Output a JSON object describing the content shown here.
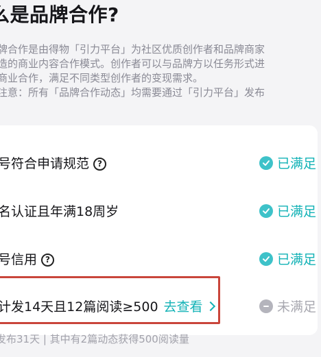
{
  "title": "么是品牌合作?",
  "description_lines": [
    "牌合作是由得物「引力平台」为社区优质创作者和品牌商家",
    "造的商业内容合作模式。创作者可以与品牌方以任务形式进",
    "商业合作，满足不同类型创作者的变现需求。",
    "注意：所有「品牌合作动态」均需要通过「引力平台」发布"
  ],
  "requirements": [
    {
      "label": "号符合申请规范",
      "help": "?",
      "status_text": "已满足",
      "status": "met"
    },
    {
      "label": "名认证且年满18周岁",
      "status_text": "已满足",
      "status": "met"
    },
    {
      "label": "号信用",
      "help": "?",
      "status_text": "已满足",
      "status": "met"
    },
    {
      "label": "计发14天且12篇阅读≥500",
      "link_text": "去查看",
      "status_text": "未满足",
      "status": "unmet"
    }
  ],
  "footnote": "发布31天 | 其中有2篇动态获得500阅读量",
  "colors": {
    "accent": "#12b2b6",
    "met_icon": "#3ec2c9",
    "unmet": "#b4b4bc",
    "highlight_border": "#c9453b"
  },
  "icons": {
    "met": "check-circle-icon",
    "unmet": "minus-circle-icon",
    "help": "question-circle-icon",
    "link": "chevron-right-icon"
  }
}
